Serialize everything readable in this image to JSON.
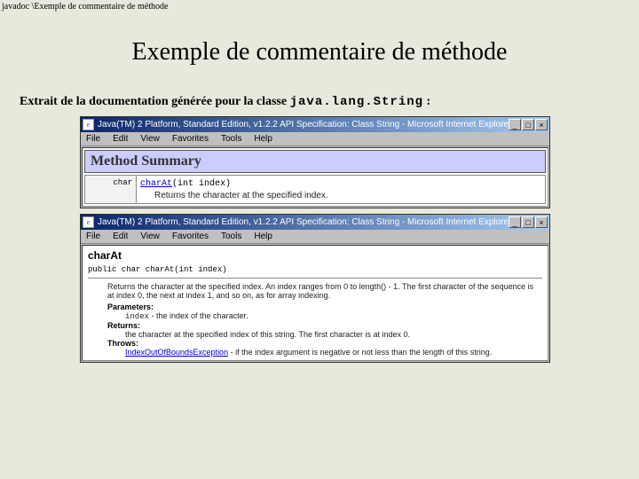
{
  "breadcrumb": "javadoc \\Exemple de commentaire de méthode",
  "title": "Exemple de commentaire de méthode",
  "intro_prefix": "Extrait de la documentation générée pour la classe ",
  "intro_class": "java.lang.String",
  "intro_suffix": " :",
  "window": {
    "title": "Java(TM) 2 Platform, Standard Edition, v1.2.2 API Specification: Class String - Microsoft Internet Explorer",
    "menus": [
      "File",
      "Edit",
      "View",
      "Favorites",
      "Tools",
      "Help"
    ],
    "btn_min": "_",
    "btn_max": "□",
    "btn_close": "×",
    "icon_glyph": "e"
  },
  "summary": {
    "header": "Method Summary",
    "return_type": "char",
    "method_link": "charAt",
    "method_sig": "(int index)",
    "method_desc": "Returns the character at the specified index."
  },
  "detail": {
    "name": "charAt",
    "signature": "public char charAt(int index)",
    "body": "Returns the character at the specified index. An index ranges from 0 to length() - 1. The first character of the sequence is at index 0, the next at index 1, and so on, as for array indexing.",
    "params_label": "Parameters:",
    "param_name": "index",
    "param_desc": " - the index of the character.",
    "returns_label": "Returns:",
    "returns_desc": "the character at the specified index of this string. The first character is at index 0.",
    "throws_label": "Throws:",
    "throws_link": "IndexOutOfBoundsException",
    "throws_desc": " - if the index argument is negative or not less than the length of this string."
  }
}
